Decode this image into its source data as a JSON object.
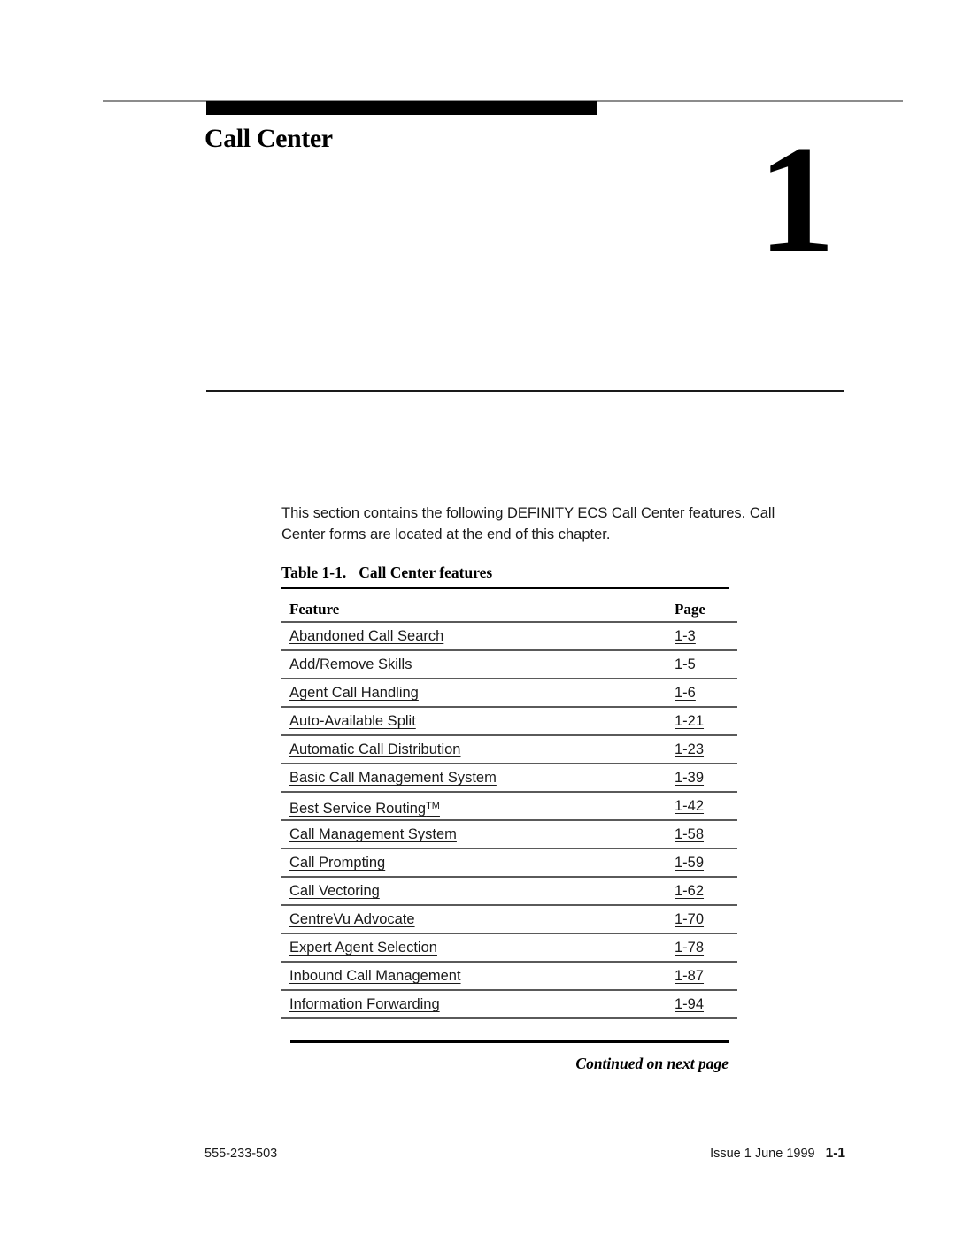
{
  "chapter": {
    "title": "Call Center",
    "number": "1"
  },
  "intro": {
    "paragraph": "This section contains the following DEFINITY ECS Call Center features. Call Center forms are located at the end of this chapter."
  },
  "table": {
    "caption_label": "Table 1-1.",
    "caption_title": "Call Center features",
    "columns": [
      "Feature",
      "Page"
    ],
    "rows": [
      {
        "feature": "Abandoned Call Search",
        "page": "1-3"
      },
      {
        "feature": "Add/Remove Skills",
        "page": "1-5"
      },
      {
        "feature": "Agent Call Handling",
        "page": "1-6"
      },
      {
        "feature": "Auto-Available Split",
        "page": "1-21"
      },
      {
        "feature": "Automatic Call Distribution",
        "page": "1-23"
      },
      {
        "feature": "Basic Call Management System",
        "page": "1-39"
      },
      {
        "feature": "Best Service Routing",
        "page": "1-42",
        "superscript": "TM"
      },
      {
        "feature": "Call Management System",
        "page": "1-58"
      },
      {
        "feature": "Call Prompting",
        "page": "1-59"
      },
      {
        "feature": "Call Vectoring",
        "page": "1-62"
      },
      {
        "feature": "CentreVu Advocate",
        "page": "1-70"
      },
      {
        "feature": "Expert Agent Selection",
        "page": "1-78"
      },
      {
        "feature": "Inbound Call Management",
        "page": "1-87"
      },
      {
        "feature": "Information Forwarding",
        "page": "1-94"
      }
    ],
    "continued_note": "Continued on next page"
  },
  "footer": {
    "document_number": "555-233-503",
    "issue": "Issue 1 June 1999",
    "page_number": "1-1"
  },
  "colors": {
    "text": "#1a1a1a",
    "rule_light": "#8c8c8c",
    "rule_dark": "#000000",
    "row_rule": "#5a5a5a"
  }
}
